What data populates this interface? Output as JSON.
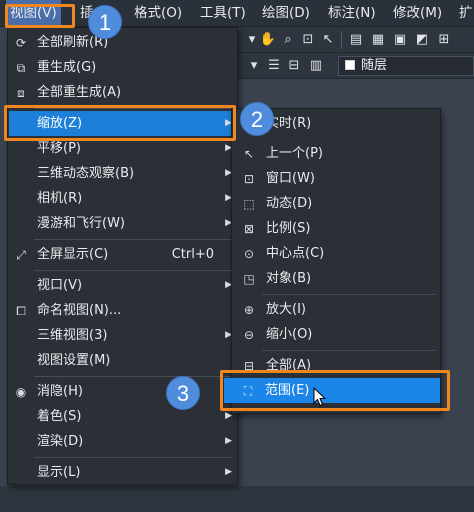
{
  "menubar": {
    "items": [
      {
        "label": "视图(V)"
      },
      {
        "label": "插"
      },
      {
        "label": "格式(O)"
      },
      {
        "label": "工具(T)"
      },
      {
        "label": "绘图(D)"
      },
      {
        "label": "标注(N)"
      },
      {
        "label": "修改(M)"
      },
      {
        "label": "扩"
      }
    ]
  },
  "toolbar": {
    "layer_value": "随层"
  },
  "view_menu": {
    "items": [
      {
        "label": "全部刷新(R)"
      },
      {
        "label": "重生成(G)"
      },
      {
        "label": "全部重生成(A)"
      },
      {
        "label": "缩放(Z)"
      },
      {
        "label": "平移(P)"
      },
      {
        "label": "三维动态观察(B)"
      },
      {
        "label": "相机(R)"
      },
      {
        "label": "漫游和飞行(W)"
      },
      {
        "label": "全屏显示(C)",
        "shortcut": "Ctrl+0"
      },
      {
        "label": "视口(V)"
      },
      {
        "label": "命名视图(N)..."
      },
      {
        "label": "三维视图(3)"
      },
      {
        "label": "视图设置(M)"
      },
      {
        "label": "消隐(H)"
      },
      {
        "label": "着色(S)"
      },
      {
        "label": "渲染(D)"
      },
      {
        "label": "显示(L)"
      }
    ]
  },
  "zoom_menu": {
    "items": [
      {
        "label": "实时(R)"
      },
      {
        "label": "上一个(P)"
      },
      {
        "label": "窗口(W)"
      },
      {
        "label": "动态(D)"
      },
      {
        "label": "比例(S)"
      },
      {
        "label": "中心点(C)"
      },
      {
        "label": "对象(B)"
      },
      {
        "label": "放大(I)"
      },
      {
        "label": "缩小(O)"
      },
      {
        "label": "全部(A)"
      },
      {
        "label": "范围(E)"
      }
    ]
  },
  "badges": [
    "1",
    "2",
    "3"
  ],
  "colors": {
    "accent_orange": "#f0871e",
    "highlight_blue": "#1e7fd9",
    "badge_blue": "#4f8ddc",
    "menu_bg": "#2b2f36"
  }
}
